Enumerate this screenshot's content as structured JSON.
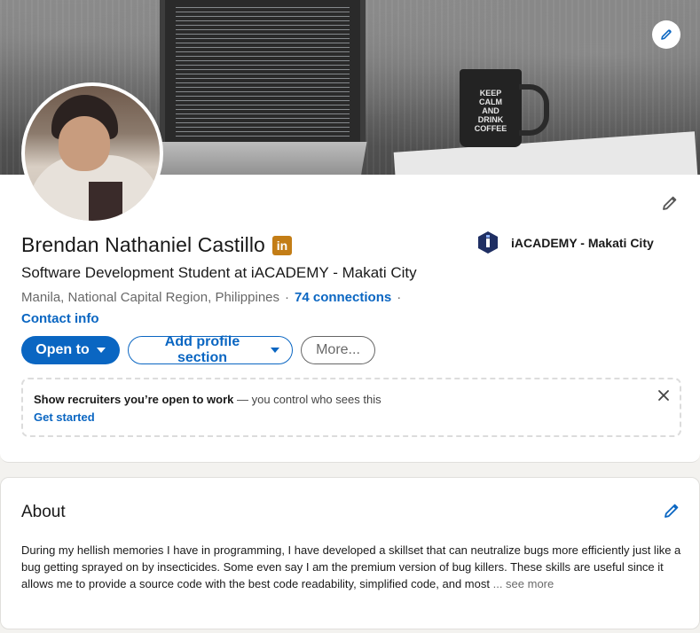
{
  "banner": {
    "mug_text": [
      "KEEP",
      "CALM",
      "AND",
      "DRINK",
      "COFFEE"
    ]
  },
  "profile": {
    "name": "Brendan Nathaniel Castillo",
    "badge": "in",
    "headline": "Software Development Student at iACADEMY - Makati City",
    "location": "Manila, National Capital Region, Philippines",
    "separator": "·",
    "connections": "74 connections",
    "contact_info": "Contact info",
    "company": "iACADEMY - Makati City"
  },
  "actions": {
    "open_to": "Open to",
    "add_section": "Add profile section",
    "more": "More..."
  },
  "open_to_work": {
    "bold": "Show recruiters you’re open to work",
    "rest": " — you control who sees this",
    "link": "Get started"
  },
  "about": {
    "title": "About",
    "text": "During my hellish memories I have in programming, I have developed a skillset that can neutralize bugs more efficiently just like a bug getting sprayed on by insecticides. Some even say I am the premium version of bug killers. These skills are useful since it allows me to provide a source code with the best code readability, simplified code, and most ",
    "see_more": "... see more"
  },
  "colors": {
    "accent": "#0a66c2",
    "badge": "#c37d16"
  }
}
